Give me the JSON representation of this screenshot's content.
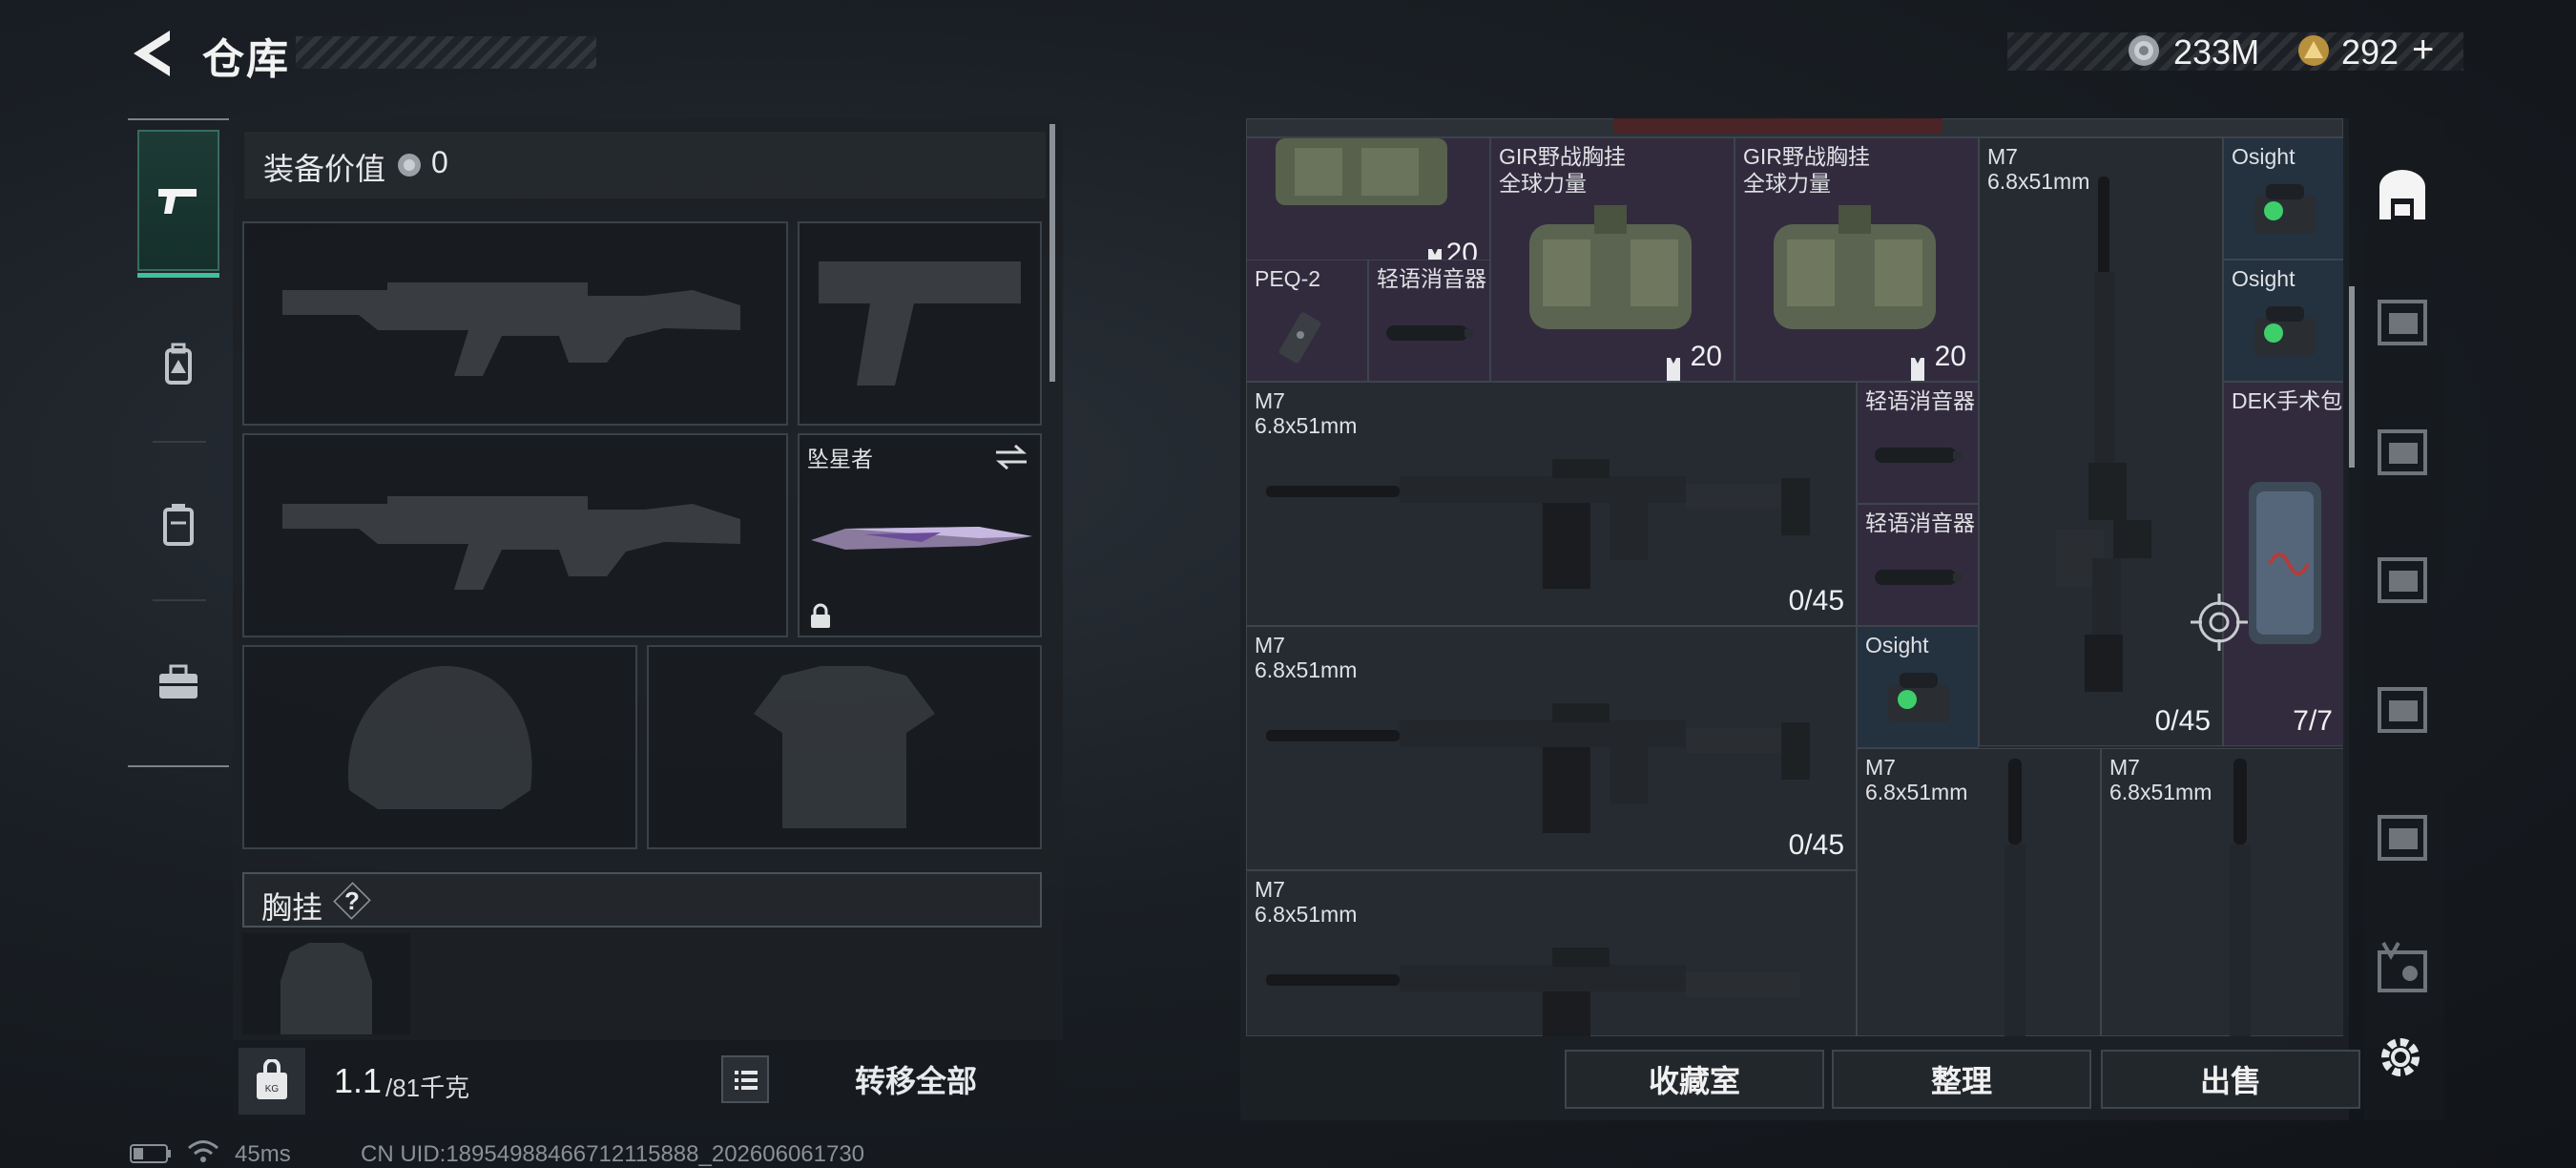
{
  "header": {
    "title": "仓库"
  },
  "currency": {
    "silver_value": "233M",
    "gold_value": "292",
    "add_symbol": "+"
  },
  "left_tabs": [
    {
      "name": "weapons",
      "icon": "pistol-icon",
      "active": true
    },
    {
      "name": "gear",
      "icon": "backpack-icon",
      "active": false
    },
    {
      "name": "containers",
      "icon": "case-icon",
      "active": false
    },
    {
      "name": "tools",
      "icon": "toolbox-icon",
      "active": false
    }
  ],
  "equipment": {
    "value_label": "装备价值",
    "value": "0",
    "melee_name": "坠星者",
    "chest_rig_label": "胸挂",
    "chest_rig_help": "?",
    "weight_current": "1.1",
    "weight_max": "/81千克",
    "transfer_all": "转移全部"
  },
  "grid_items": {
    "top_left_count": "20",
    "gir1_name1": "GIR野战胸挂",
    "gir1_name2": "全球力量",
    "gir1_count": "20",
    "gir2_name1": "GIR野战胸挂",
    "gir2_name2": "全球力量",
    "gir2_count": "20",
    "m7_tall_name1": "M7",
    "m7_tall_name2": "6.8x51mm",
    "m7_tall_ammo": "0/45",
    "osight1": "Osight",
    "osight2": "Osight",
    "peq": "PEQ-2",
    "suppressor1": "轻语消音器",
    "m7a_name1": "M7",
    "m7a_name2": "6.8x51mm",
    "m7a_ammo": "0/45",
    "suppressor2": "轻语消音器",
    "suppressor3": "轻语消音器",
    "dek_name": "DEK手术包",
    "dek_count": "7/7",
    "m7b_name1": "M7",
    "m7b_name2": "6.8x51mm",
    "m7b_ammo": "0/45",
    "osight3": "Osight",
    "m7c_name1": "M7",
    "m7c_name2": "6.8x51mm",
    "m7d_name1": "M7",
    "m7d_name2": "6.8x51mm",
    "m7e_name1": "M7",
    "m7e_name2": "6.8x51mm"
  },
  "bottom_buttons": {
    "collection": "收藏室",
    "sort": "整理",
    "sell": "出售"
  },
  "status": {
    "ping": "45ms",
    "uid": "CN UID:18954988466712115888_202606061730"
  },
  "colors": {
    "accent_green": "#3fbf9a",
    "rare_purple": "#322b3e",
    "blue_item": "#24313f"
  }
}
